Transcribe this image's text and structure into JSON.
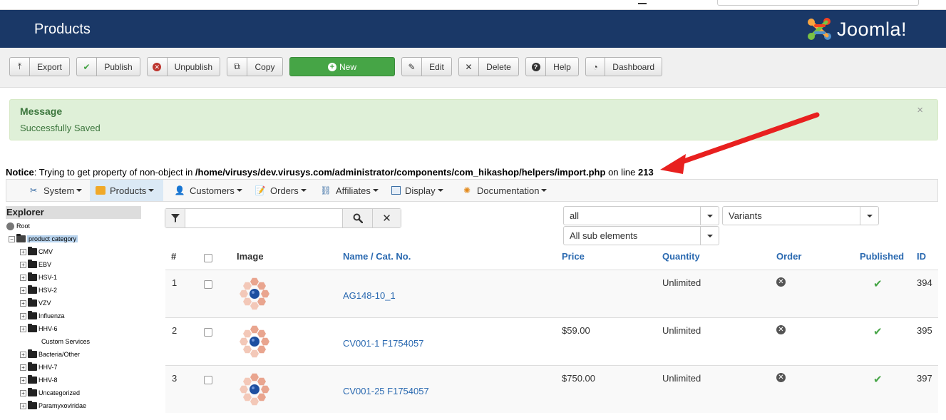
{
  "header": {
    "title": "Products",
    "logo_text": "Joomla!"
  },
  "toolbar": {
    "export": "Export",
    "publish": "Publish",
    "unpublish": "Unpublish",
    "copy": "Copy",
    "new": "New",
    "edit": "Edit",
    "delete": "Delete",
    "help": "Help",
    "dashboard": "Dashboard"
  },
  "message": {
    "heading": "Message",
    "text": "Successfully Saved",
    "close": "×"
  },
  "notice": {
    "label": "Notice",
    "text": ": Trying to get property of non-object in ",
    "path": "/home/virusys/dev.virusys.com/administrator/components/com_hikashop/helpers/import.php",
    "on_line": " on line ",
    "line": "213"
  },
  "menu": {
    "system": "System",
    "products": "Products",
    "customers": "Customers",
    "orders": "Orders",
    "affiliates": "Affiliates",
    "display": "Display",
    "documentation": "Documentation"
  },
  "explorer": {
    "title": "Explorer",
    "root": "Root",
    "category": "product category",
    "items": [
      "CMV",
      "EBV",
      "HSV-1",
      "HSV-2",
      "VZV",
      "Influenza",
      "HHV-6",
      "Custom Services",
      "Bacteria/Other",
      "HHV-7",
      "HHV-8",
      "Uncategorized",
      "Paramyxoviridae"
    ]
  },
  "filters": {
    "search_value": "",
    "category_filter": "all",
    "variants_filter": "Variants",
    "sub_elements_filter": "All sub elements"
  },
  "table": {
    "headers": {
      "num": "#",
      "image": "Image",
      "name": "Name / Cat. No.",
      "price": "Price",
      "quantity": "Quantity",
      "order": "Order",
      "published": "Published",
      "id": "ID"
    },
    "rows": [
      {
        "num": "1",
        "name": "AG148-10_1",
        "price": "",
        "quantity": "Unlimited",
        "id": "394"
      },
      {
        "num": "2",
        "name": "CV001-1 F1754057",
        "price": "$59.00",
        "quantity": "Unlimited",
        "id": "395"
      },
      {
        "num": "3",
        "name": "CV001-25 F1754057",
        "price": "$750.00",
        "quantity": "Unlimited",
        "id": "397"
      }
    ]
  },
  "colors": {
    "header_bg": "#1a3867",
    "new_button": "#46a546",
    "success_bg": "#dff0d8",
    "link": "#2a69b0",
    "annotation_arrow": "#e8201f"
  }
}
